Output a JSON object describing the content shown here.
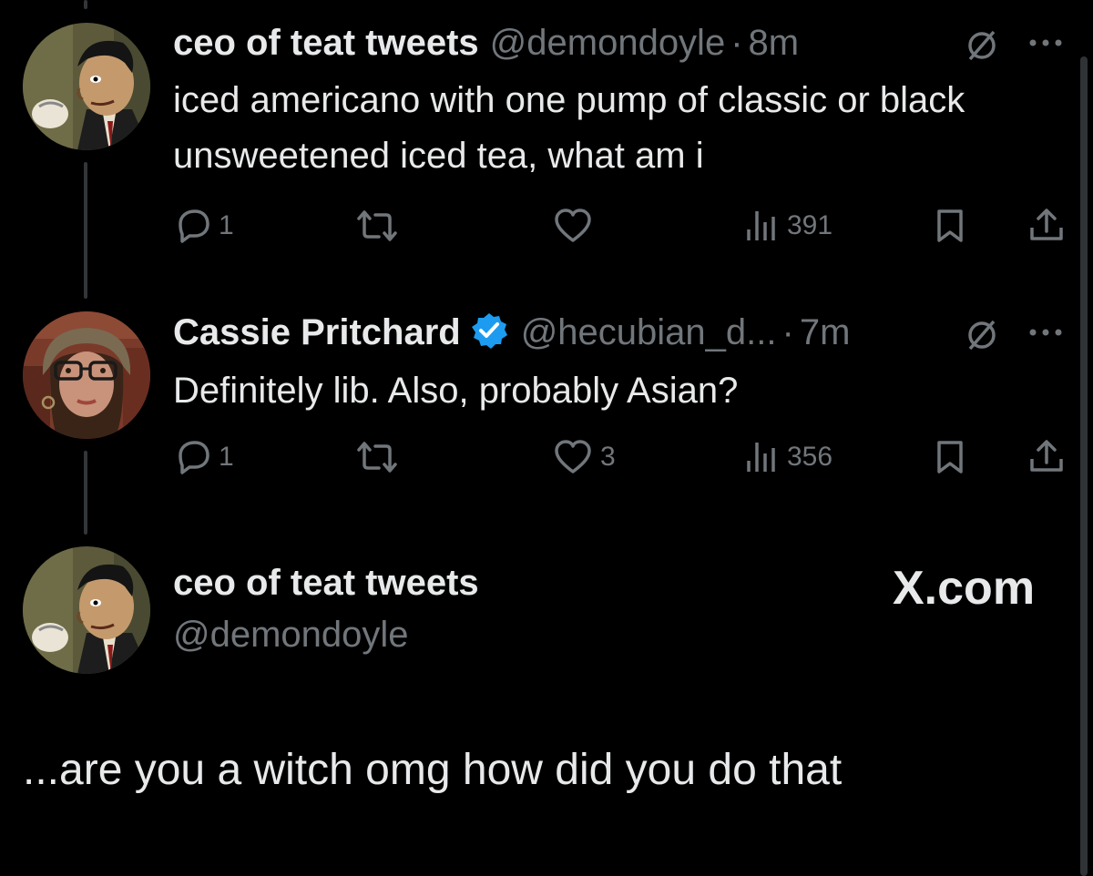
{
  "tweets": [
    {
      "display_name": "ceo of teat tweets",
      "handle": "@demondoyle",
      "sep": "·",
      "time": "8m",
      "text": "iced americano with one pump of classic or black unsweetened iced tea, what am i",
      "actions": {
        "replies": "1",
        "retweets": "",
        "likes": "",
        "views": "391"
      }
    },
    {
      "display_name": "Cassie Pritchard",
      "verified": true,
      "handle": "@hecubian_d...",
      "sep": "·",
      "time": "7m",
      "text": "Definitely lib. Also, probably Asian?",
      "actions": {
        "replies": "1",
        "retweets": "",
        "likes": "3",
        "views": "356"
      }
    }
  ],
  "compose": {
    "display_name": "ceo of teat tweets",
    "handle": "@demondoyle",
    "brand": "X.com",
    "text": "...are you a witch omg how did you do that"
  },
  "colors": {
    "background": "#000000",
    "text": "#e7e9ea",
    "muted": "#71767b",
    "verified": "#1d9bf0"
  },
  "icons": [
    "reply-icon",
    "retweet-icon",
    "like-icon",
    "views-icon",
    "bookmark-icon",
    "share-icon",
    "grok-icon",
    "more-icon",
    "verified-badge-icon"
  ]
}
